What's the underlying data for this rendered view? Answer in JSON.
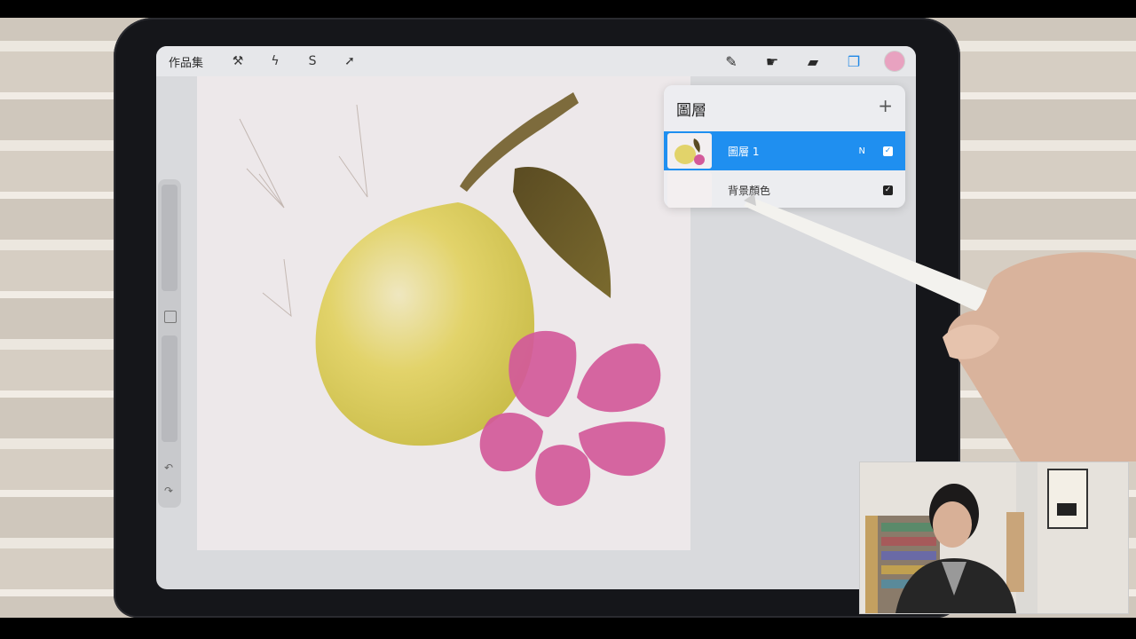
{
  "topbar": {
    "gallery_label": "作品集",
    "left_tools": [
      {
        "name": "wrench-icon",
        "glyph": "⚒"
      },
      {
        "name": "magic-wand-icon",
        "glyph": "ϟ"
      },
      {
        "name": "selection-icon",
        "glyph": "S"
      },
      {
        "name": "transform-arrow-icon",
        "glyph": "➚"
      }
    ],
    "right_tools": [
      {
        "name": "brush-icon",
        "glyph": "✎"
      },
      {
        "name": "smudge-icon",
        "glyph": "☛"
      },
      {
        "name": "eraser-icon",
        "glyph": "▰"
      },
      {
        "name": "layers-icon",
        "glyph": "❐"
      }
    ],
    "current_color": "#e8a2c0"
  },
  "layers_panel": {
    "title": "圖層",
    "add_glyph": "+",
    "layers": [
      {
        "name": "圖層 1",
        "blend_mode": "N",
        "visible": true,
        "selected": true
      },
      {
        "name": "背景顏色",
        "visible": true,
        "selected": false
      }
    ]
  },
  "colors": {
    "accent": "#1f8ff0",
    "lemon": "#e2d36a",
    "leaf": "#6b5a2a",
    "petal": "#d35a9a"
  }
}
